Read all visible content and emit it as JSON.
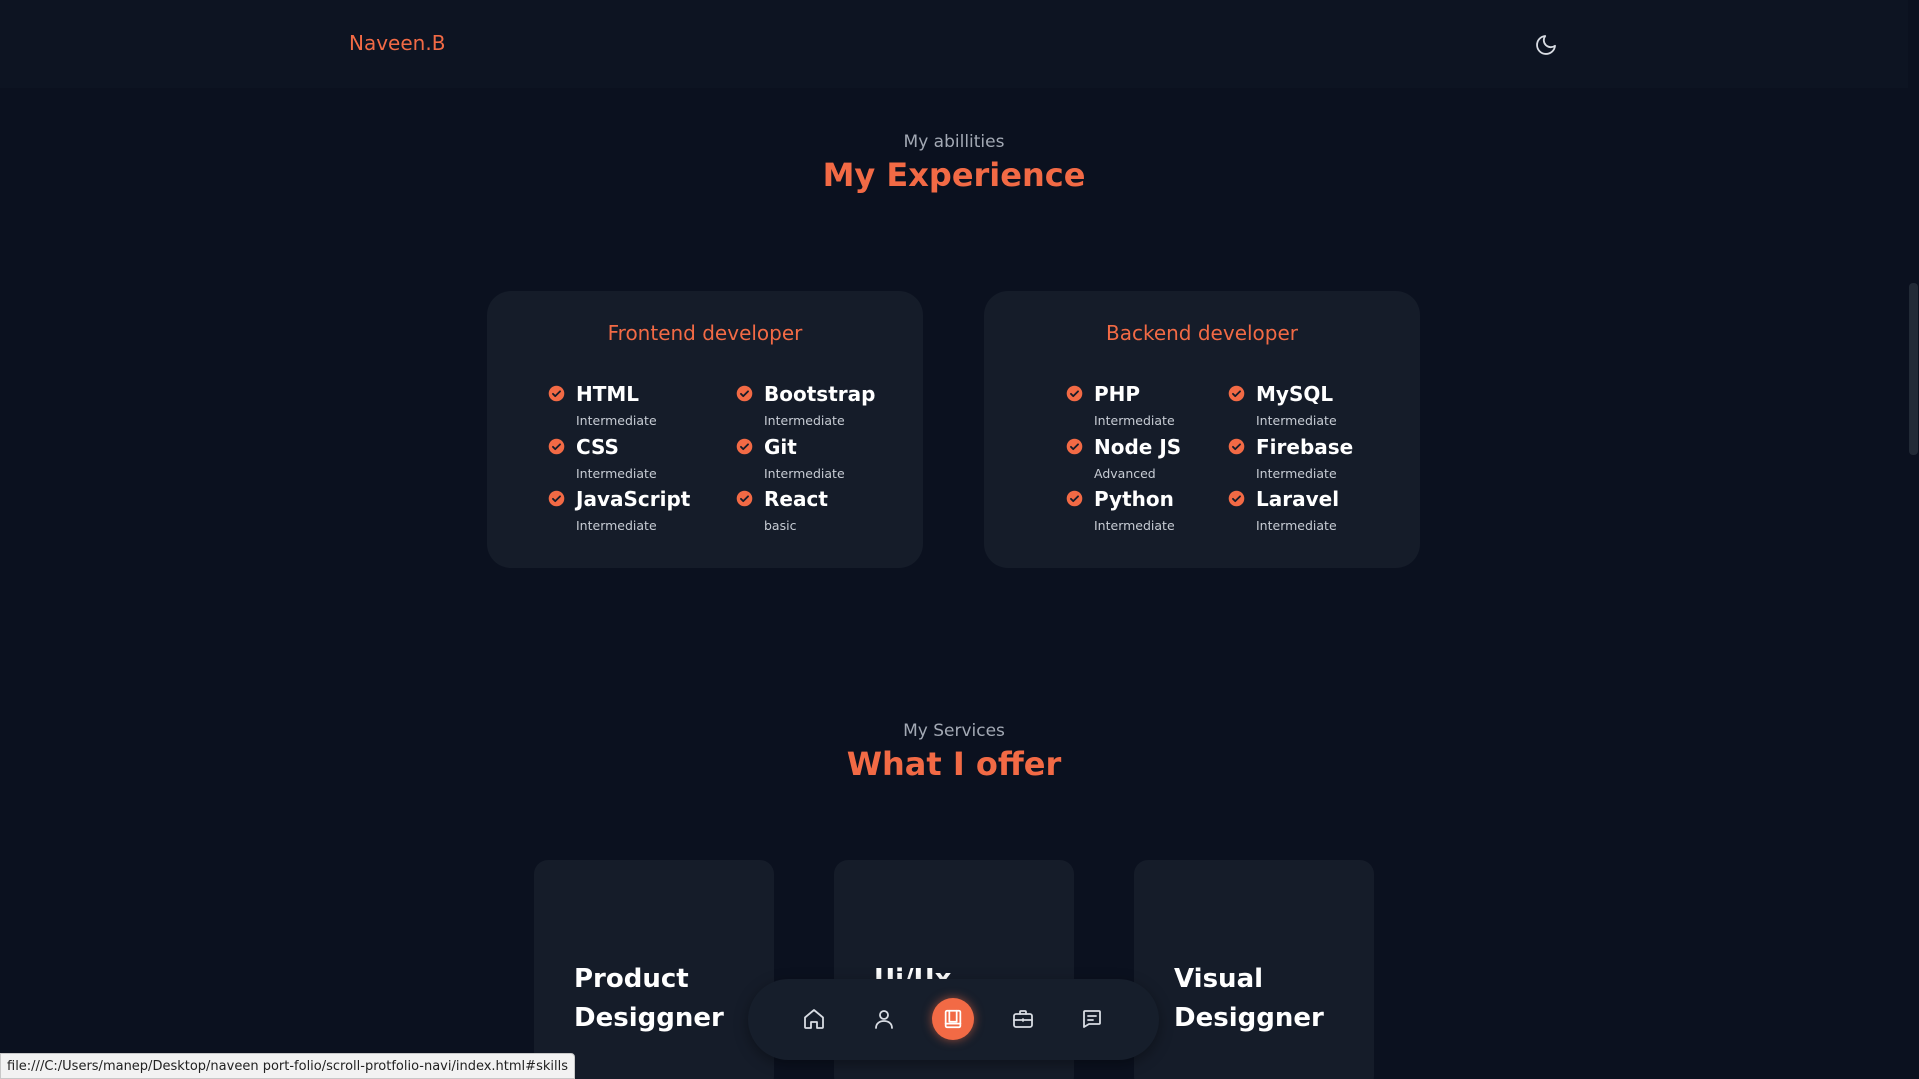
{
  "header": {
    "logo": "Naveen.B",
    "theme_toggle_icon": "moon-icon"
  },
  "experience": {
    "subtitle": "My abillities",
    "title": "My Experience",
    "cards": [
      {
        "title": "Frontend developer",
        "skills": [
          {
            "name": "HTML",
            "level": "Intermediate"
          },
          {
            "name": "CSS",
            "level": "Intermediate"
          },
          {
            "name": "JavaScript",
            "level": "Intermediate"
          },
          {
            "name": "Bootstrap",
            "level": "Intermediate"
          },
          {
            "name": "Git",
            "level": "Intermediate"
          },
          {
            "name": "React",
            "level": "basic"
          }
        ]
      },
      {
        "title": "Backend developer",
        "skills": [
          {
            "name": "PHP",
            "level": "Intermediate"
          },
          {
            "name": "Node JS",
            "level": "Advanced"
          },
          {
            "name": "Python",
            "level": "Intermediate"
          },
          {
            "name": "MySQL",
            "level": "Intermediate"
          },
          {
            "name": "Firebase",
            "level": "Intermediate"
          },
          {
            "name": "Laravel",
            "level": "Intermediate"
          }
        ]
      }
    ]
  },
  "services": {
    "subtitle": "My Services",
    "title": "What I offer",
    "cards": [
      {
        "title": "Product Desiggner"
      },
      {
        "title": "Ui/Ux"
      },
      {
        "title": "Visual Desiggner"
      }
    ]
  },
  "bottom_nav": {
    "items": [
      {
        "icon": "home-icon",
        "active": false
      },
      {
        "icon": "user-icon",
        "active": false
      },
      {
        "icon": "book-icon",
        "active": true
      },
      {
        "icon": "briefcase-icon",
        "active": false
      },
      {
        "icon": "message-icon",
        "active": false
      }
    ]
  },
  "status_bar": {
    "url": "file:///C:/Users/manep/Desktop/naveen port-folio/scroll-protfolio-navi/index.html#skills"
  },
  "colors": {
    "accent": "#f26a45",
    "background": "#0b111f",
    "card": "#151c29"
  }
}
